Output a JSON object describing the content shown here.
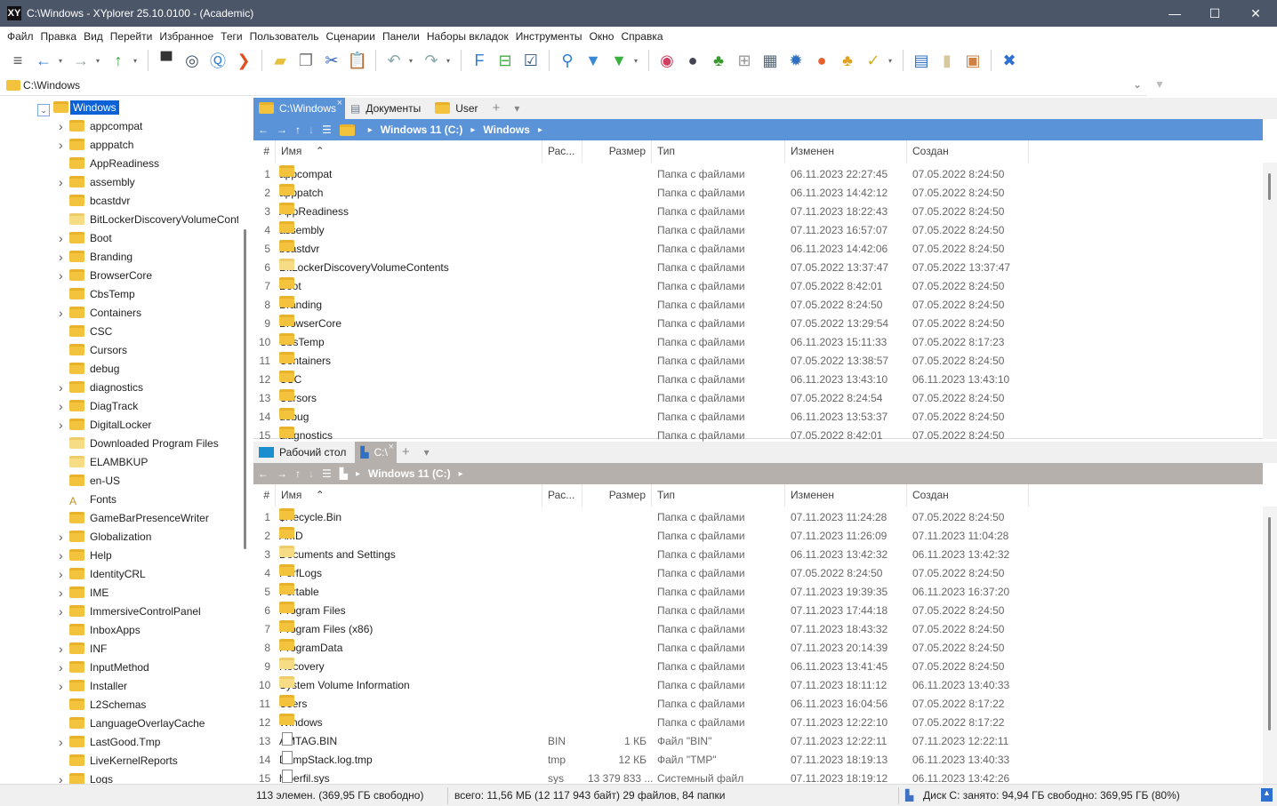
{
  "window": {
    "title": "C:\\Windows - XYplorer 25.10.0100 - (Academic)",
    "logo": "XY",
    "minimize": "—",
    "maximize": "☐",
    "close": "✕"
  },
  "menu": [
    "Файл",
    "Правка",
    "Вид",
    "Перейти",
    "Избранное",
    "Теги",
    "Пользователь",
    "Сценарии",
    "Панели",
    "Наборы вкладок",
    "Инструменты",
    "Окно",
    "Справка"
  ],
  "toolbar": [
    {
      "icon": "menu-icon",
      "glyph": "≡",
      "color": "#555"
    },
    {
      "icon": "back-arrow-icon",
      "glyph": "←",
      "color": "#2d7fd8",
      "dd": true
    },
    {
      "icon": "forward-arrow-icon",
      "glyph": "→",
      "color": "#9aa5a0",
      "dd": true
    },
    {
      "icon": "up-arrow-icon",
      "glyph": "↑",
      "color": "#2fa33a",
      "dd": true
    },
    "sep",
    {
      "icon": "computer-icon",
      "glyph": "▀",
      "color": "#333"
    },
    {
      "icon": "target-icon",
      "glyph": "◎",
      "color": "#456"
    },
    {
      "icon": "search-circle-icon",
      "glyph": "Ⓠ",
      "color": "#2d7fd8"
    },
    {
      "icon": "goto-icon",
      "glyph": "❯",
      "color": "#e05020"
    },
    "sep",
    {
      "icon": "new-folder-icon",
      "glyph": "▰",
      "color": "#e8c040"
    },
    {
      "icon": "copy-icon",
      "glyph": "❐",
      "color": "#777"
    },
    {
      "icon": "scissors-icon",
      "glyph": "✂",
      "color": "#3060c0"
    },
    {
      "icon": "paste-icon",
      "glyph": "📋",
      "color": "#c9a86a"
    },
    "sep",
    {
      "icon": "undo-icon",
      "glyph": "↶",
      "color": "#8aa",
      "dd": true
    },
    {
      "icon": "redo-icon",
      "glyph": "↷",
      "color": "#8aa",
      "dd": true
    },
    "sep",
    {
      "icon": "find-files-icon",
      "glyph": "F",
      "color": "#2d7fd8"
    },
    {
      "icon": "tree-toggle-icon",
      "glyph": "⊟",
      "color": "#4a4"
    },
    {
      "icon": "checkbox-icon",
      "glyph": "☑",
      "color": "#357"
    },
    "sep",
    {
      "icon": "search-icon",
      "glyph": "⚲",
      "color": "#2d7fd8"
    },
    {
      "icon": "filter-icon",
      "glyph": "▼",
      "color": "#3a8ad8"
    },
    {
      "icon": "filter-green-icon",
      "glyph": "▼",
      "color": "#3ab040",
      "dd": true
    },
    "sep",
    {
      "icon": "spiral-icon",
      "glyph": "◉",
      "color": "#d04060"
    },
    {
      "icon": "moon-icon",
      "glyph": "●",
      "color": "#445"
    },
    {
      "icon": "tree-icon",
      "glyph": "♣",
      "color": "#3a9a30"
    },
    {
      "icon": "grid-icon",
      "glyph": "⊞",
      "color": "#999"
    },
    {
      "icon": "thumbnails-icon",
      "glyph": "▦",
      "color": "#567"
    },
    {
      "icon": "badge-icon",
      "glyph": "✹",
      "color": "#3070c0"
    },
    {
      "icon": "ball-icon",
      "glyph": "●",
      "color": "#e86030"
    },
    {
      "icon": "colors-icon",
      "glyph": "♣",
      "color": "#e0a020"
    },
    {
      "icon": "paint-roller-icon",
      "glyph": "✓",
      "color": "#d0b020",
      "dd": true
    },
    "sep",
    {
      "icon": "dual-pane-icon",
      "glyph": "▤",
      "color": "#3070c0"
    },
    {
      "icon": "single-pane-icon",
      "glyph": "▮",
      "color": "#d8c8a0"
    },
    {
      "icon": "preview-icon",
      "glyph": "▣",
      "color": "#d08040"
    },
    "sep",
    {
      "icon": "tools-icon",
      "glyph": "✖",
      "color": "#2d70d0"
    }
  ],
  "address": {
    "value": "C:\\Windows"
  },
  "tree": {
    "root": "Windows",
    "items": [
      {
        "n": "appcompat",
        "e": true
      },
      {
        "n": "apppatch",
        "e": true
      },
      {
        "n": "AppReadiness",
        "e": false
      },
      {
        "n": "assembly",
        "e": true
      },
      {
        "n": "bcastdvr",
        "e": false
      },
      {
        "n": "BitLockerDiscoveryVolumeContents",
        "e": false,
        "pale": true
      },
      {
        "n": "Boot",
        "e": true
      },
      {
        "n": "Branding",
        "e": true
      },
      {
        "n": "BrowserCore",
        "e": true
      },
      {
        "n": "CbsTemp",
        "e": false
      },
      {
        "n": "Containers",
        "e": true
      },
      {
        "n": "CSC",
        "e": false
      },
      {
        "n": "Cursors",
        "e": false
      },
      {
        "n": "debug",
        "e": false
      },
      {
        "n": "diagnostics",
        "e": true
      },
      {
        "n": "DiagTrack",
        "e": true
      },
      {
        "n": "DigitalLocker",
        "e": true
      },
      {
        "n": "Downloaded Program Files",
        "e": false,
        "pale": true
      },
      {
        "n": "ELAMBKUP",
        "e": false,
        "pale": true
      },
      {
        "n": "en-US",
        "e": false
      },
      {
        "n": "Fonts",
        "e": false,
        "fonts": true
      },
      {
        "n": "GameBarPresenceWriter",
        "e": false
      },
      {
        "n": "Globalization",
        "e": true
      },
      {
        "n": "Help",
        "e": true
      },
      {
        "n": "IdentityCRL",
        "e": true
      },
      {
        "n": "IME",
        "e": true
      },
      {
        "n": "ImmersiveControlPanel",
        "e": true
      },
      {
        "n": "InboxApps",
        "e": false
      },
      {
        "n": "INF",
        "e": true
      },
      {
        "n": "InputMethod",
        "e": true
      },
      {
        "n": "Installer",
        "e": true
      },
      {
        "n": "L2Schemas",
        "e": false
      },
      {
        "n": "LanguageOverlayCache",
        "e": false
      },
      {
        "n": "LastGood.Tmp",
        "e": true
      },
      {
        "n": "LiveKernelReports",
        "e": false
      },
      {
        "n": "Logs",
        "e": true
      }
    ]
  },
  "columns": {
    "num": "#",
    "name": "Имя",
    "ext": "Рас...",
    "size": "Размер",
    "type": "Тип",
    "modified": "Изменен",
    "created": "Создан"
  },
  "top": {
    "tabs": [
      {
        "label": "C:\\Windows",
        "active": true,
        "icon": "folder-icon"
      },
      {
        "label": "Документы",
        "icon": "documents-icon"
      },
      {
        "label": "User",
        "icon": "folder-icon"
      }
    ],
    "crumbs": [
      "Windows 11 (C:)",
      "Windows"
    ],
    "accent": "#5b93d8",
    "rows": [
      [
        "1",
        "appcompat",
        "",
        "",
        "Папка с файлами",
        "06.11.2023 22:27:45",
        "07.05.2022 8:24:50"
      ],
      [
        "2",
        "apppatch",
        "",
        "",
        "Папка с файлами",
        "06.11.2023 14:42:12",
        "07.05.2022 8:24:50"
      ],
      [
        "3",
        "AppReadiness",
        "",
        "",
        "Папка с файлами",
        "07.11.2023 18:22:43",
        "07.05.2022 8:24:50"
      ],
      [
        "4",
        "assembly",
        "",
        "",
        "Папка с файлами",
        "07.11.2023 16:57:07",
        "07.05.2022 8:24:50"
      ],
      [
        "5",
        "bcastdvr",
        "",
        "",
        "Папка с файлами",
        "06.11.2023 14:42:06",
        "07.05.2022 8:24:50"
      ],
      [
        "6",
        "BitLockerDiscoveryVolumeContents",
        "",
        "",
        "Папка с файлами",
        "07.05.2022 13:37:47",
        "07.05.2022 13:37:47"
      ],
      [
        "7",
        "Boot",
        "",
        "",
        "Папка с файлами",
        "07.05.2022 8:42:01",
        "07.05.2022 8:24:50"
      ],
      [
        "8",
        "Branding",
        "",
        "",
        "Папка с файлами",
        "07.05.2022 8:24:50",
        "07.05.2022 8:24:50"
      ],
      [
        "9",
        "BrowserCore",
        "",
        "",
        "Папка с файлами",
        "07.05.2022 13:29:54",
        "07.05.2022 8:24:50"
      ],
      [
        "10",
        "CbsTemp",
        "",
        "",
        "Папка с файлами",
        "06.11.2023 15:11:33",
        "07.05.2022 8:17:23"
      ],
      [
        "11",
        "Containers",
        "",
        "",
        "Папка с файлами",
        "07.05.2022 13:38:57",
        "07.05.2022 8:24:50"
      ],
      [
        "12",
        "CSC",
        "",
        "",
        "Папка с файлами",
        "06.11.2023 13:43:10",
        "06.11.2023 13:43:10"
      ],
      [
        "13",
        "Cursors",
        "",
        "",
        "Папка с файлами",
        "07.05.2022 8:24:54",
        "07.05.2022 8:24:50"
      ],
      [
        "14",
        "debug",
        "",
        "",
        "Папка с файлами",
        "06.11.2023 13:53:37",
        "07.05.2022 8:24:50"
      ],
      [
        "15",
        "diagnostics",
        "",
        "",
        "Папка с файлами",
        "07.05.2022 8:42:01",
        "07.05.2022 8:24:50"
      ]
    ]
  },
  "bottom": {
    "tabs": [
      {
        "label": "Рабочий стол",
        "icon": "desktop-icon"
      },
      {
        "label": "C:\\",
        "active": true,
        "icon": "drive-icon"
      }
    ],
    "crumbs": [
      "Windows 11 (C:)"
    ],
    "accent": "#b5b0ac",
    "rows": [
      [
        "1",
        "$Recycle.Bin",
        "",
        "",
        "Папка с файлами",
        "07.11.2023 11:24:28",
        "07.05.2022 8:24:50"
      ],
      [
        "2",
        "AMD",
        "",
        "",
        "Папка с файлами",
        "07.11.2023 11:26:09",
        "07.11.2023 11:04:28"
      ],
      [
        "3",
        "Documents and Settings",
        "",
        "",
        "Папка с файлами",
        "06.11.2023 13:42:32",
        "06.11.2023 13:42:32"
      ],
      [
        "4",
        "PerfLogs",
        "",
        "",
        "Папка с файлами",
        "07.05.2022 8:24:50",
        "07.05.2022 8:24:50"
      ],
      [
        "5",
        "Portable",
        "",
        "",
        "Папка с файлами",
        "07.11.2023 19:39:35",
        "06.11.2023 16:37:20"
      ],
      [
        "6",
        "Program Files",
        "",
        "",
        "Папка с файлами",
        "07.11.2023 17:44:18",
        "07.05.2022 8:24:50"
      ],
      [
        "7",
        "Program Files (x86)",
        "",
        "",
        "Папка с файлами",
        "07.11.2023 18:43:32",
        "07.05.2022 8:24:50"
      ],
      [
        "8",
        "ProgramData",
        "",
        "",
        "Папка с файлами",
        "07.11.2023 20:14:39",
        "07.05.2022 8:24:50"
      ],
      [
        "9",
        "Recovery",
        "",
        "",
        "Папка с файлами",
        "06.11.2023 13:41:45",
        "07.05.2022 8:24:50"
      ],
      [
        "10",
        "System Volume Information",
        "",
        "",
        "Папка с файлами",
        "07.11.2023 18:11:12",
        "06.11.2023 13:40:33"
      ],
      [
        "11",
        "Users",
        "",
        "",
        "Папка с файлами",
        "06.11.2023 16:04:56",
        "07.05.2022 8:17:22"
      ],
      [
        "12",
        "Windows",
        "",
        "",
        "Папка с файлами",
        "07.11.2023 12:22:10",
        "07.05.2022 8:17:22"
      ],
      [
        "13",
        "AMTAG.BIN",
        "BIN",
        "1 КБ",
        "Файл \"BIN\"",
        "07.11.2023 12:22:11",
        "07.11.2023 12:22:11"
      ],
      [
        "14",
        "DumpStack.log.tmp",
        "tmp",
        "12 КБ",
        "Файл \"TMP\"",
        "07.11.2023 18:19:13",
        "06.11.2023 13:40:33"
      ],
      [
        "15",
        "hiberfil.sys",
        "sys",
        "13 379 833 ...",
        "Системный файл",
        "07.11.2023 18:19:12",
        "06.11.2023 13:42:26"
      ]
    ]
  },
  "status": {
    "items": "113 элемен. (369,95 ГБ свободно)",
    "total": "всего: 11,56 МБ (12 117 943 байт) 29 файлов, 84 папки",
    "disk": "Диск C:  занято: 94,94 ГБ   свободно: 369,95 ГБ (80%)",
    "disk_free_percent": 80
  }
}
